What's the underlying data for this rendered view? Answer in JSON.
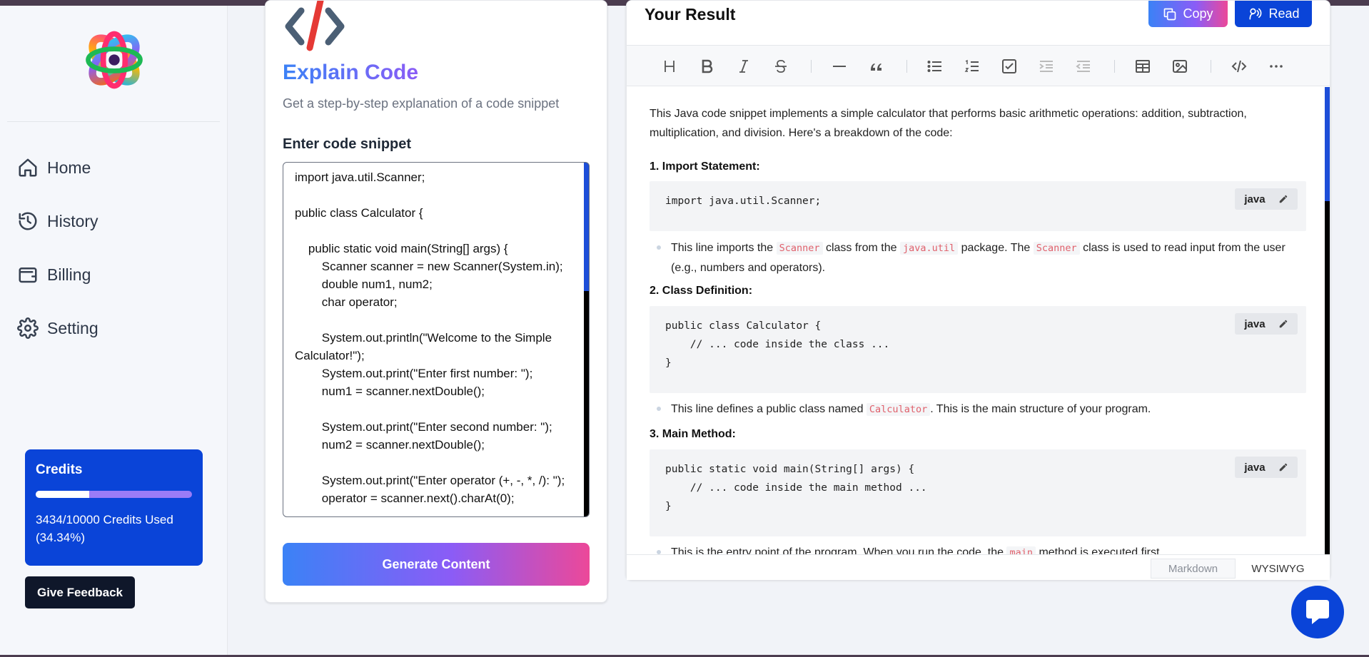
{
  "sidebar": {
    "nav": [
      {
        "label": "Home",
        "icon": "home-icon"
      },
      {
        "label": "History",
        "icon": "history-icon"
      },
      {
        "label": "Billing",
        "icon": "wallet-icon"
      },
      {
        "label": "Setting",
        "icon": "gear-icon"
      }
    ],
    "credits": {
      "title": "Credits",
      "used_text": "3434/10000 Credits Used (34.34%)",
      "used_fraction": 0.3434
    },
    "feedback_label": "Give Feedback"
  },
  "tool": {
    "title": "Explain Code",
    "subtitle": "Get a step-by-step explanation of a code snippet",
    "input_label": "Enter code snippet",
    "code_value": "import java.util.Scanner;\n\npublic class Calculator {\n\n    public static void main(String[] args) {\n        Scanner scanner = new Scanner(System.in);\n        double num1, num2;\n        char operator;\n\n        System.out.println(\"Welcome to the Simple Calculator!\");\n        System.out.print(\"Enter first number: \");\n        num1 = scanner.nextDouble();\n\n        System.out.print(\"Enter second number: \");\n        num2 = scanner.nextDouble();\n\n        System.out.print(\"Enter operator (+, -, *, /): \");\n        operator = scanner.next().charAt(0);",
    "generate_label": "Generate Content"
  },
  "result": {
    "title": "Your Result",
    "copy_label": "Copy",
    "read_label": "Read",
    "intro": "This Java code snippet implements a simple calculator that performs basic arithmetic operations: addition, subtraction, multiplication, and division. Here's a breakdown of the code:",
    "sections": [
      {
        "heading": "1. Import Statement:",
        "code": "import java.util.Scanner;",
        "lang": "java",
        "bullet_parts": [
          "This line imports the ",
          "Scanner",
          " class from the ",
          "java.util",
          " package. The ",
          "Scanner",
          " class is used to read input from the user (e.g., numbers and operators)."
        ]
      },
      {
        "heading": "2. Class Definition:",
        "code": "public class Calculator {\n    // ... code inside the class ...\n}",
        "lang": "java",
        "bullet_parts": [
          "This line defines a public class named ",
          "Calculator",
          ". This is the main structure of your program."
        ]
      },
      {
        "heading": "3. Main Method:",
        "code": "public static void main(String[] args) {\n    // ... code inside the main method ...\n}",
        "lang": "java",
        "bullet_parts": [
          "This is the entry point of the program. When you run the code, the ",
          "main",
          " method is executed first."
        ]
      }
    ],
    "mode_tabs": [
      "Markdown",
      "WYSIWYG"
    ]
  }
}
